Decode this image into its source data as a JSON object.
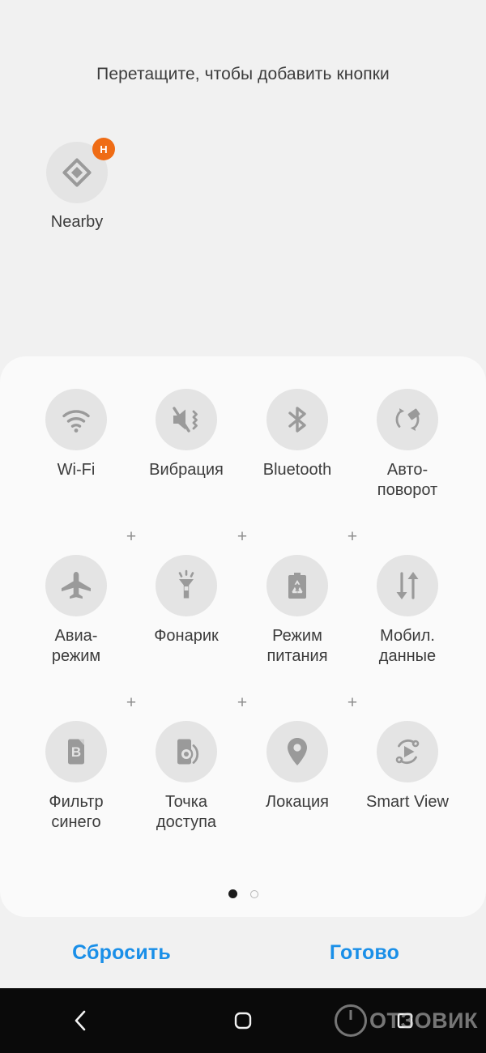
{
  "prompt": "Перетащите, чтобы добавить кнопки",
  "staging": {
    "tiles": [
      {
        "label": "Nearby",
        "icon": "nearby-share-icon",
        "badge": "H",
        "badge_color": "#ef6c15"
      }
    ]
  },
  "panel": {
    "rows": [
      {
        "tiles": [
          {
            "label": "Wi-Fi",
            "icon": "wifi-icon"
          },
          {
            "label": "Вибрация",
            "icon": "vibrate-mute-icon"
          },
          {
            "label": "Bluetooth",
            "icon": "bluetooth-icon"
          },
          {
            "label": "Авто-\nповорот",
            "icon": "auto-rotate-icon"
          }
        ],
        "plus_markers": 0
      },
      {
        "tiles": [
          {
            "label": "Авиа-\nрежим",
            "icon": "airplane-icon"
          },
          {
            "label": "Фонарик",
            "icon": "flashlight-icon"
          },
          {
            "label": "Режим\nпитания",
            "icon": "power-saving-battery-icon"
          },
          {
            "label": "Мобил.\nданные",
            "icon": "mobile-data-arrows-icon"
          }
        ],
        "plus_markers": 3
      },
      {
        "tiles": [
          {
            "label": "Фильтр\nсинего",
            "icon": "blue-light-filter-icon"
          },
          {
            "label": "Точка\nдоступа",
            "icon": "hotspot-icon"
          },
          {
            "label": "Локация",
            "icon": "location-pin-icon"
          },
          {
            "label": "Smart View",
            "icon": "smart-view-icon"
          }
        ],
        "plus_markers": 3
      }
    ],
    "plus_marker": "+",
    "pagination": {
      "pages": 2,
      "current": 1
    }
  },
  "actions": {
    "reset_label": "Сбросить",
    "done_label": "Готово",
    "accent_color": "#1a8fe8"
  },
  "navbar": {
    "back": "back-chevron-icon",
    "home": "home-square-icon",
    "recents": "recents-icon"
  },
  "watermark": {
    "text": "ОТЗОВИК"
  },
  "colors": {
    "background": "#f1f1f1",
    "panel": "#fafafa",
    "tile_circle": "#e4e4e4",
    "icon": "#9a9a9a",
    "label": "#3c3c3c"
  }
}
